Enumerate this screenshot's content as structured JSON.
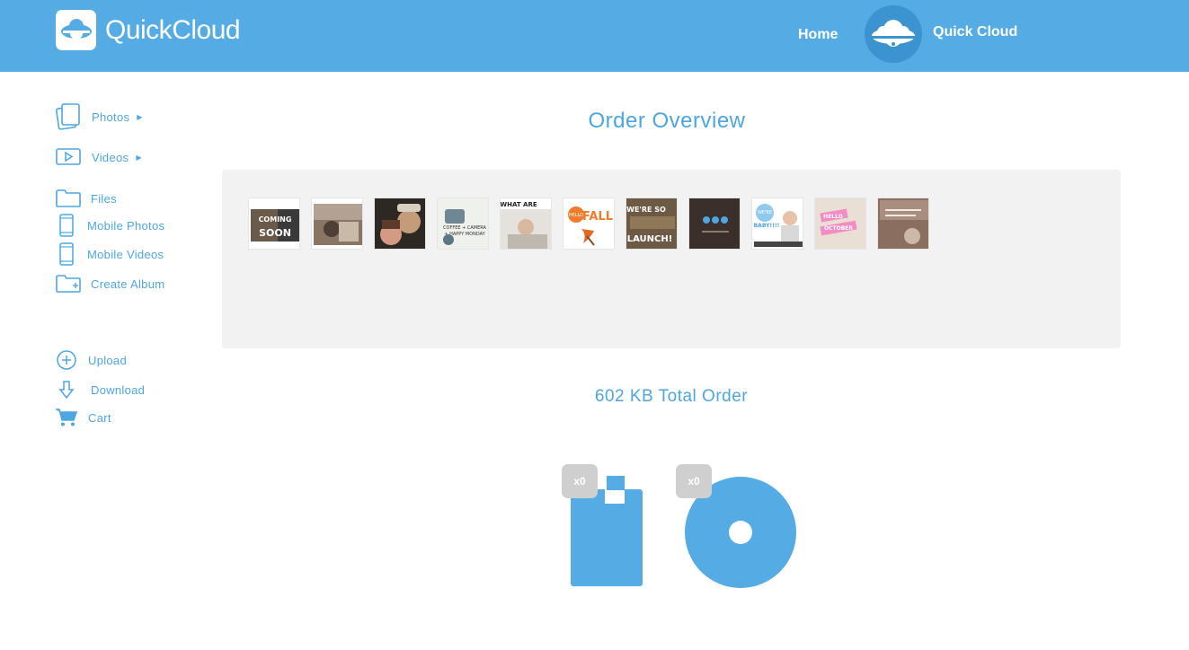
{
  "header": {
    "logo_light": "Quick",
    "logo_bold": "Cloud",
    "nav_home": "Home",
    "user_name": "Quick Cloud",
    "bg_color": "#55ace4"
  },
  "sidebar": {
    "items": [
      {
        "label": "Photos",
        "icon": "photos-icon"
      },
      {
        "label": "Videos",
        "icon": "video-icon"
      },
      {
        "label": "Files",
        "icon": "folder-icon"
      },
      {
        "label": "Mobile Photos",
        "icon": "mobile-icon"
      },
      {
        "label": "Mobile Videos",
        "icon": "mobile-icon"
      },
      {
        "label": "Create Album",
        "icon": "folder-plus-icon"
      },
      {
        "label": "Upload",
        "icon": "plus-circle-icon"
      },
      {
        "label": "Download",
        "icon": "download-arrow-icon"
      },
      {
        "label": "Cart",
        "icon": "cart-icon"
      }
    ]
  },
  "main": {
    "title": "Order Overview",
    "total": "602 KB Total Order",
    "thumbnails": [
      {
        "caption_a": "COMING",
        "caption_b": "SOON"
      },
      {
        "caption_a": "",
        "caption_b": ""
      },
      {
        "caption_a": "",
        "caption_b": ""
      },
      {
        "caption_a": "COFFEE + CAMERA",
        "caption_b": "+ HAPPY MONDAY"
      },
      {
        "caption_a": "WHAT ARE",
        "caption_b": ""
      },
      {
        "caption_a": "HELLO",
        "caption_b": "FALL"
      },
      {
        "caption_a": "WE'RE SO",
        "caption_b": "LAUNCH!"
      },
      {
        "caption_a": "",
        "caption_b": ""
      },
      {
        "caption_a": "WE'RE",
        "caption_b": "BABY!!!!"
      },
      {
        "caption_a": "HELLO",
        "caption_b": "OCTOBER"
      },
      {
        "caption_a": "",
        "caption_b": ""
      }
    ],
    "products": [
      {
        "name": "usb-drive",
        "count": "x0"
      },
      {
        "name": "disc",
        "count": "x0"
      }
    ]
  },
  "colors": {
    "accent": "#4da6e0",
    "header": "#55ace4",
    "panel": "#f2f2f2",
    "badge": "#cfcfcf"
  }
}
